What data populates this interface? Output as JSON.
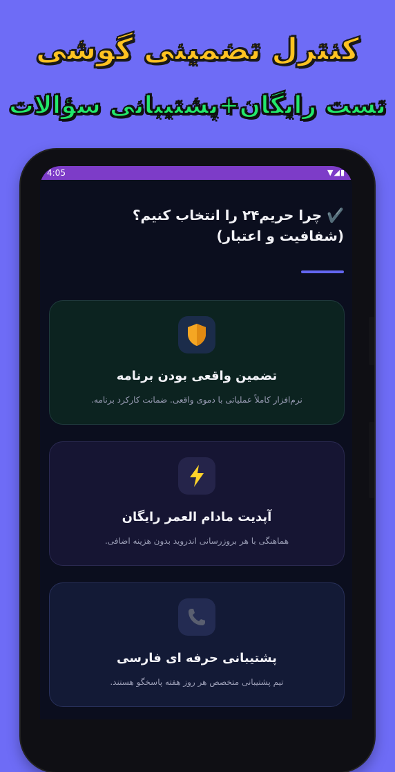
{
  "banner": {
    "line1": "کنترل تضمینی گوشی",
    "line2": "تست رایگان+پشتیبانی سؤالات"
  },
  "statusbar": {
    "time": "4:05",
    "icons": [
      "wifi-icon",
      "signal-icon",
      "battery-icon"
    ]
  },
  "section": {
    "heading_line1": "✔️ چرا حریم۲۴ را انتخاب کنیم؟",
    "heading_line2": "(شفافیت و اعتبار)",
    "accent_color": "#6366f1"
  },
  "cards": [
    {
      "icon": "shield-icon",
      "title": "تضمین واقعی بودن برنامه",
      "desc": "نرم‌افزار کاملاً عملیاتی با دموی واقعی. ضمانت کارکرد برنامه."
    },
    {
      "icon": "lightning-icon",
      "title": "آپدیت مادام العمر رایگان",
      "desc": "هماهنگی با هر بروزرسانی اندروید بدون هزینه اضافی."
    },
    {
      "icon": "phone-icon",
      "title": "پشتیبانی حرفه ای فارسی",
      "desc": "تیم پشتیبانی متخصص هر روز هفته پاسخگو هستند."
    }
  ]
}
